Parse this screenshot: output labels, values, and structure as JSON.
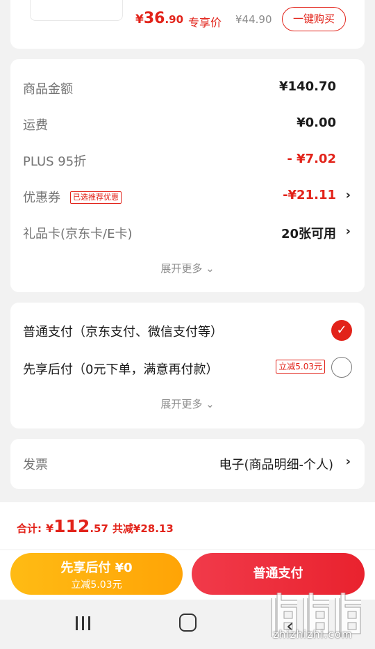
{
  "product": {
    "price_currency": "¥",
    "price_int": "36",
    "price_dec": ".90",
    "price_tag": "专享价",
    "price_old": "¥44.90",
    "buy_button": "一键购买"
  },
  "summary": {
    "rows": [
      {
        "label": "商品金额",
        "value": "¥140.70"
      },
      {
        "label": "运费",
        "value": "¥0.00"
      },
      {
        "label": "PLUS 95折",
        "value": "- ¥7.02"
      },
      {
        "label": "优惠券",
        "tag": "已选推荐优惠",
        "value": "-¥21.11",
        "chevron": "›"
      },
      {
        "label": "礼品卡(京东卡/E卡)",
        "value": "20张可用",
        "chevron": "›"
      }
    ],
    "expand": "展开更多 ⌄"
  },
  "payment": {
    "options": [
      {
        "label": "普通支付（京东支付、微信支付等）",
        "selected": true
      },
      {
        "label": "先享后付（0元下单，满意再付款）",
        "tag": "立减5.03元",
        "selected": false
      }
    ],
    "expand": "展开更多 ⌄"
  },
  "invoice": {
    "label": "发票",
    "value": "电子(商品明细-个人)",
    "chevron": "›"
  },
  "bottom": {
    "total_label": "合计:",
    "total_currency": "¥",
    "total_int": "112",
    "total_dec": ".57",
    "total_save": "共减¥28.13",
    "later_button_line1": "先享后付 ¥0",
    "later_button_line2": "立减5.03元",
    "normal_button": "普通支付"
  },
  "watermark": {
    "glyphs": "值值值",
    "text": "zhizhizhi.com"
  },
  "colors": {
    "accent": "#e2231a",
    "orange": "#ffa406",
    "page_bg": "#f2f2f2"
  }
}
